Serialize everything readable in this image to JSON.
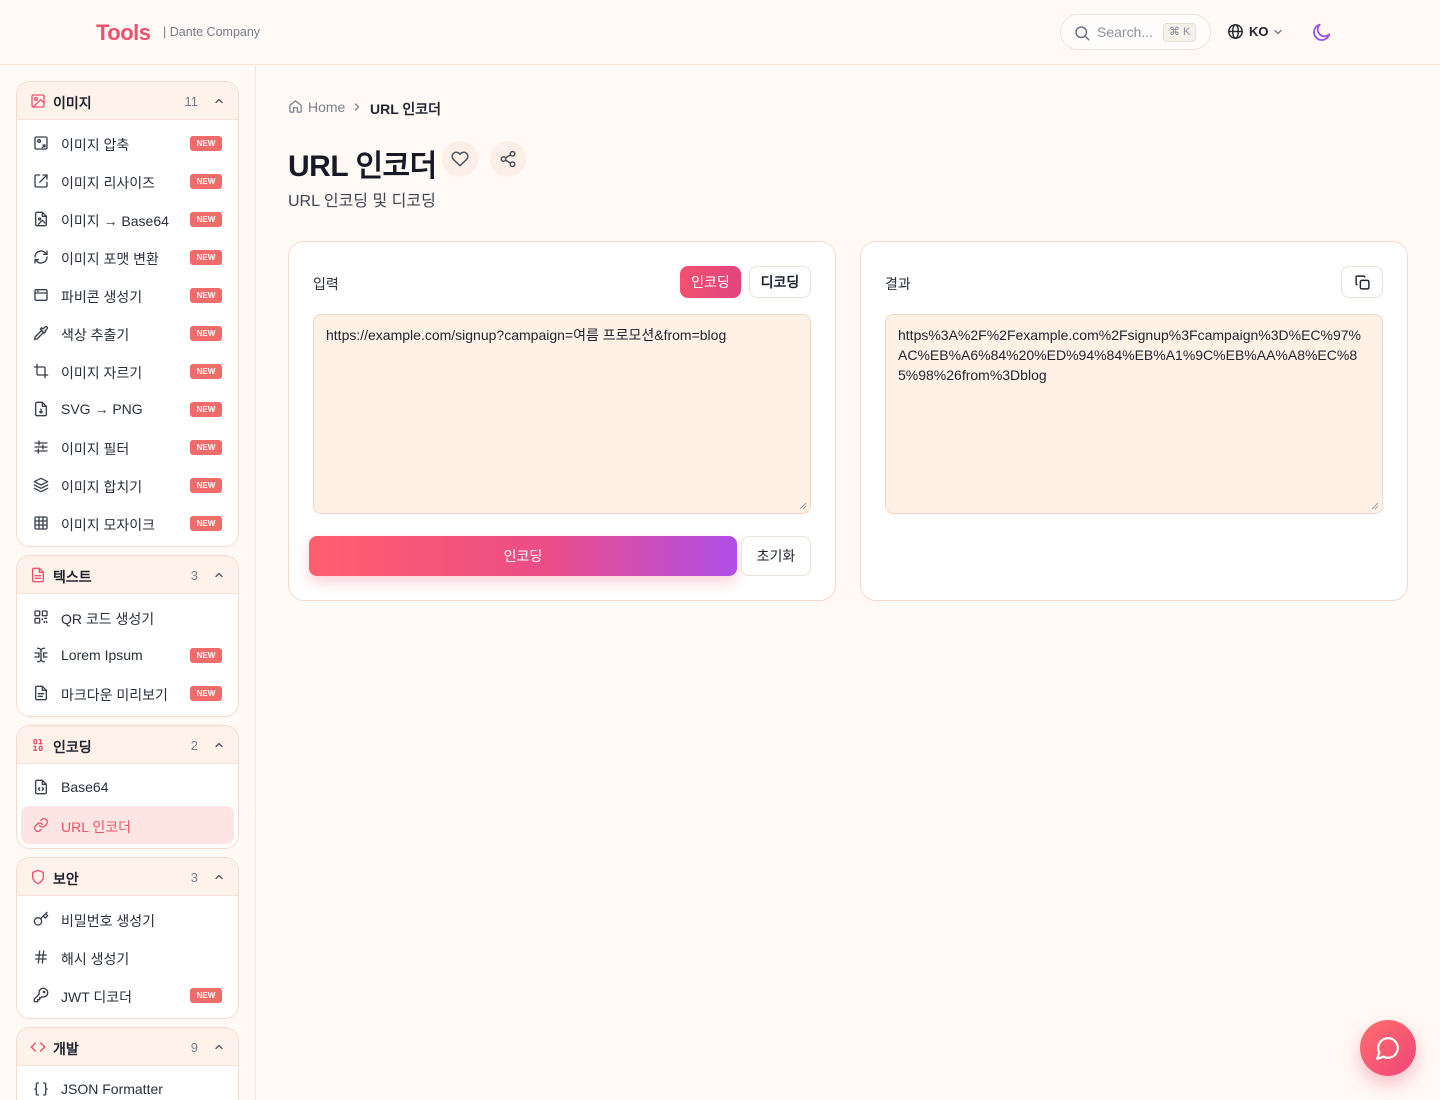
{
  "header": {
    "logo": "Tools",
    "company": "| Dante Company",
    "search_placeholder": "Search...",
    "search_shortcut": "⌘ K",
    "language": "KO"
  },
  "breadcrumb": {
    "home": "Home",
    "current": "URL 인코더"
  },
  "page": {
    "title": "URL 인코더",
    "subtitle": "URL 인코딩 및 디코딩"
  },
  "input_panel": {
    "label": "입력",
    "mode_encode": "인코딩",
    "mode_decode": "디코딩",
    "value": "https://example.com/signup?campaign=여름 프로모션&from=blog",
    "action_label": "인코딩",
    "reset_label": "초기화"
  },
  "result_panel": {
    "label": "결과",
    "value": "https%3A%2F%2Fexample.com%2Fsignup%3Fcampaign%3D%EC%97%AC%EB%A6%84%20%ED%94%84%EB%A1%9C%EB%AA%A8%EC%85%98%26from%3Dblog"
  },
  "sidebar": {
    "new_badge": "NEW",
    "groups": [
      {
        "title": "이미지",
        "count": "11",
        "icon": "image-icon",
        "items": [
          {
            "label": "이미지 압축",
            "icon": "image-compress-icon",
            "badge": true
          },
          {
            "label": "이미지 리사이즈",
            "icon": "resize-icon",
            "badge": true
          },
          {
            "label": "이미지 → Base64",
            "icon": "file-image-icon",
            "badge": true
          },
          {
            "label": "이미지 포맷 변환",
            "icon": "refresh-icon",
            "badge": true
          },
          {
            "label": "파비콘 생성기",
            "icon": "browser-window-icon",
            "badge": true
          },
          {
            "label": "색상 추출기",
            "icon": "pipette-icon",
            "badge": true
          },
          {
            "label": "이미지 자르기",
            "icon": "crop-icon",
            "badge": true
          },
          {
            "label": "SVG → PNG",
            "icon": "file-code-icon",
            "badge": true
          },
          {
            "label": "이미지 필터",
            "icon": "sliders-icon",
            "badge": true
          },
          {
            "label": "이미지 합치기",
            "icon": "layers-icon",
            "badge": true
          },
          {
            "label": "이미지 모자이크",
            "icon": "grid-icon",
            "badge": true
          }
        ]
      },
      {
        "title": "텍스트",
        "count": "3",
        "icon": "file-text-icon",
        "items": [
          {
            "label": "QR 코드 생성기",
            "icon": "qr-code-icon",
            "badge": false
          },
          {
            "label": "Lorem Ipsum",
            "icon": "text-cursor-icon",
            "badge": true
          },
          {
            "label": "마크다운 미리보기",
            "icon": "document-icon",
            "badge": true
          }
        ]
      },
      {
        "title": "인코딩",
        "count": "2",
        "icon": "binary-icon",
        "items": [
          {
            "label": "Base64",
            "icon": "file-code-icon",
            "badge": false
          },
          {
            "label": "URL 인코더",
            "icon": "link-icon",
            "badge": false,
            "active": true
          }
        ]
      },
      {
        "title": "보안",
        "count": "3",
        "icon": "shield-icon",
        "items": [
          {
            "label": "비밀번호 생성기",
            "icon": "key-icon",
            "badge": false
          },
          {
            "label": "해시 생성기",
            "icon": "hash-icon",
            "badge": false
          },
          {
            "label": "JWT 디코더",
            "icon": "key-round-icon",
            "badge": true
          }
        ]
      },
      {
        "title": "개발",
        "count": "9",
        "icon": "code-icon",
        "items": [
          {
            "label": "JSON Formatter",
            "icon": "braces-icon",
            "badge": false
          }
        ]
      }
    ]
  },
  "colors": {
    "accent": "#f0506e",
    "accent_gradient_end": "#b04ee8",
    "background": "#fffaf5",
    "badge": "#f26b6b",
    "active_item_bg": "#fde5e3"
  }
}
